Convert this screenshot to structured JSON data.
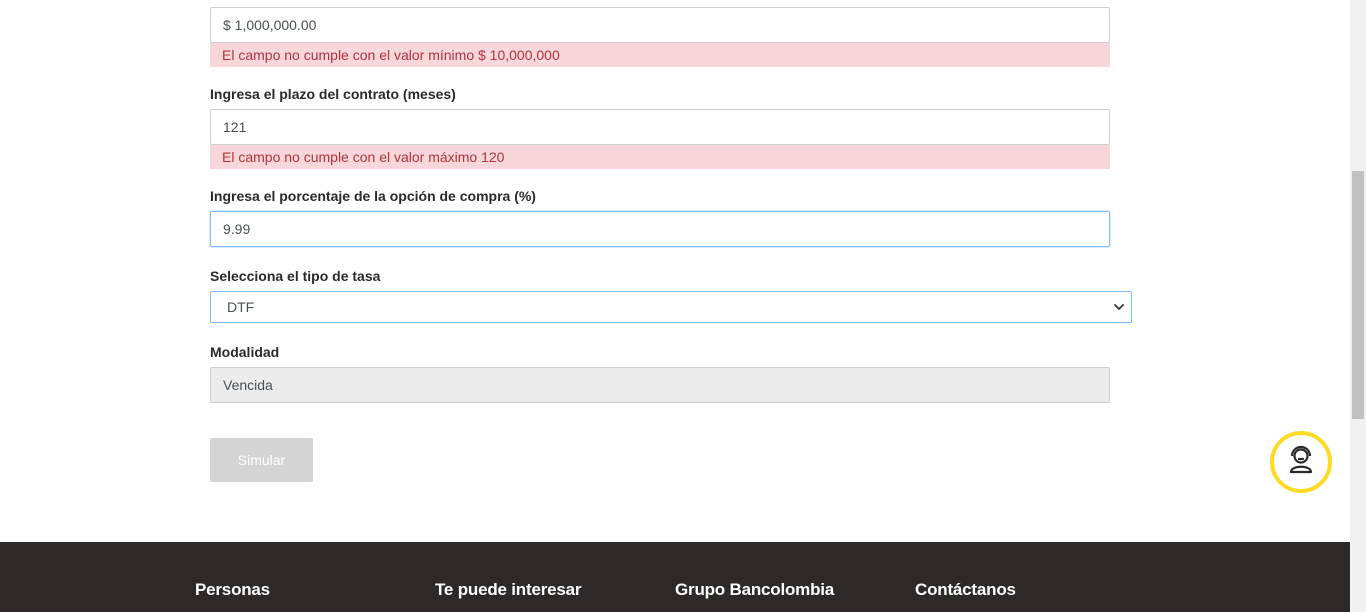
{
  "form": {
    "amount": {
      "value": "$ 1,000,000.00",
      "error": "El campo no cumple con el valor mínimo $ 10,000,000"
    },
    "term": {
      "label": "Ingresa el plazo del contrato (meses)",
      "value": "121",
      "error": "El campo no cumple con el valor máximo 120"
    },
    "purchase_option": {
      "label": "Ingresa el porcentaje de la opción de compra (%)",
      "value": "9.99"
    },
    "rate_type": {
      "label": "Selecciona el tipo de tasa",
      "selected": "DTF"
    },
    "modality": {
      "label": "Modalidad",
      "value": "Vencida"
    },
    "submit_label": "Simular"
  },
  "support_icon": "support-agent-icon",
  "footer": {
    "columns": [
      "Personas",
      "Te puede interesar",
      "Grupo Bancolombia",
      "Contáctanos"
    ]
  },
  "colors": {
    "error_bg": "#f8d7da",
    "error_text": "#b0343c",
    "footer_bg": "#2c2a29",
    "accent_yellow": "#fdda24",
    "button_disabled": "#d4d4d4"
  }
}
